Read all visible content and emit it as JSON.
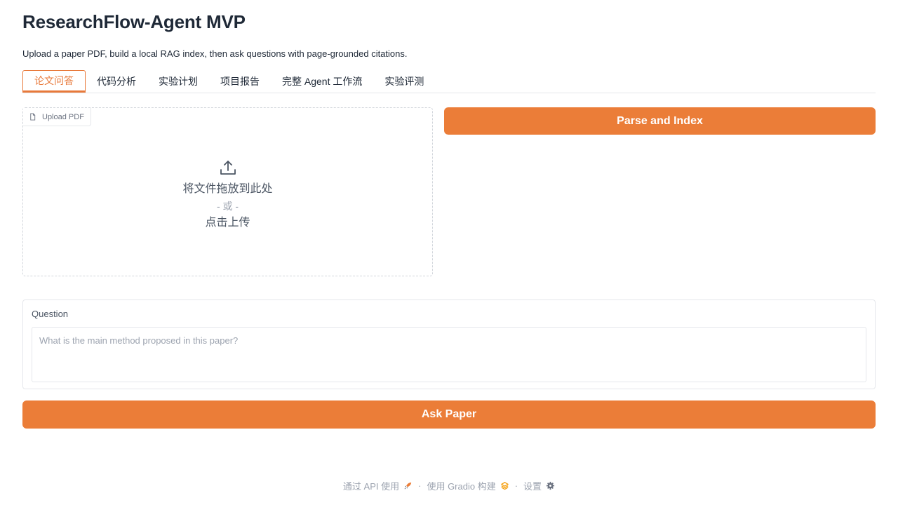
{
  "header": {
    "title": "ResearchFlow-Agent MVP",
    "subtitle": "Upload a paper PDF, build a local RAG index, then ask questions with page-grounded citations."
  },
  "tabs": [
    {
      "label": "论文问答",
      "active": true
    },
    {
      "label": "代码分析",
      "active": false
    },
    {
      "label": "实验计划",
      "active": false
    },
    {
      "label": "项目报告",
      "active": false
    },
    {
      "label": "完整 Agent 工作流",
      "active": false
    },
    {
      "label": "实验评测",
      "active": false
    }
  ],
  "upload": {
    "label": "Upload PDF",
    "drop_text": "将文件拖放到此处",
    "or_text": "- 或 -",
    "click_text": "点击上传"
  },
  "parse_button": {
    "label": "Parse and Index"
  },
  "question": {
    "label": "Question",
    "placeholder": "What is the main method proposed in this paper?",
    "value": ""
  },
  "ask_button": {
    "label": "Ask Paper"
  },
  "footer": {
    "api_label": "通过 API 使用",
    "separator": "·",
    "built_label": "使用 Gradio 构建",
    "settings_label": "设置"
  },
  "colors": {
    "accent": "#eb7d38",
    "tab_active": "#e8793a"
  }
}
